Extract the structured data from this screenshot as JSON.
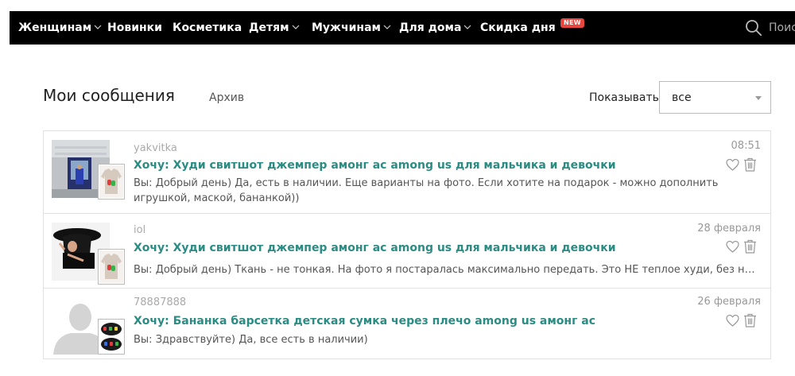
{
  "nav": {
    "items": [
      {
        "label": "Женщинам",
        "dropdown": true
      },
      {
        "label": "Новинки",
        "dropdown": false
      },
      {
        "label": "Косметика",
        "dropdown": false
      },
      {
        "label": "Детям",
        "dropdown": true
      },
      {
        "label": "Мужчинам",
        "dropdown": true
      },
      {
        "label": "Для дома",
        "dropdown": true
      },
      {
        "label": "Скидка дня",
        "dropdown": false
      }
    ],
    "new_badge": "NEW",
    "search_placeholder": "Поиск",
    "search_icon": "search-icon"
  },
  "page": {
    "title": "Мои сообщения",
    "archive_label": "Архив",
    "show_label": "Показывать:",
    "filter": {
      "value": "все",
      "icon": "triangle-down"
    }
  },
  "messages": [
    {
      "user": "yakvitka",
      "subject": "Хочу: Худи свитшот джемпер амонг ас among us для мальчика и девочки",
      "preview": "Вы: Добрый день) Да, есть в наличии. Еще варианты на фото. Если хотите на подарок - можно дополнить игрушкой, маской, бананкой))",
      "time": "08:51"
    },
    {
      "user": "iol",
      "subject": "Хочу: Худи свитшот джемпер амонг ас among us для мальчика и девочки",
      "preview": "Вы: Добрый день) Ткань - не тонкая. На фото я постаралась максимально передать. Это НЕ теплое худи, без начеса внутри, но по составу оно плотнее, чем обычная футболка.",
      "time": "28 февраля"
    },
    {
      "user": "78887888",
      "subject": "Хочу: Бананка барсетка детская сумка через плечо among us амонг ас",
      "preview": "Вы: Здравствуйте) Да, все есть в наличии)",
      "time": "26 февраля"
    }
  ],
  "colors": {
    "nav_bg": "#000000",
    "link_teal": "#2a8c83",
    "badge_red": "#e8473f",
    "muted": "#aaaaaa"
  },
  "icons": [
    "heart-icon",
    "trash-icon",
    "chevron-down-icon",
    "search-icon"
  ]
}
